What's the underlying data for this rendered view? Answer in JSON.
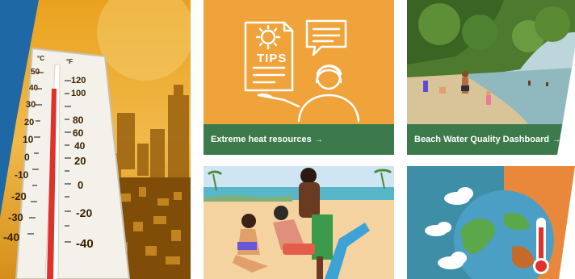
{
  "hero": {
    "image_label": "Thermometer over Boston skyline in heat",
    "scale_labels": [
      "120",
      "100",
      "80",
      "60",
      "40",
      "20",
      "0",
      "-20",
      "-40"
    ],
    "left_scale_labels": [
      "50",
      "40",
      "30",
      "20",
      "10",
      "0",
      "-10",
      "-20",
      "-30",
      "-40"
    ],
    "unit_c": "°C",
    "unit_f": "°F"
  },
  "tiles": [
    {
      "id": "extreme-heat",
      "title": "Extreme heat resources",
      "arrow": "→",
      "illustration_text": "TIPS",
      "bg_color": "#f1a33b",
      "caption_color": "#3c7a4c"
    },
    {
      "id": "beach-water",
      "title": "Beach Water Quality Dashboard",
      "arrow": "→",
      "caption_color": "#3c7a4c"
    },
    {
      "id": "sun-safety",
      "title": ""
    },
    {
      "id": "climate",
      "title": ""
    }
  ],
  "colors": {
    "accent_blue": "#1f68a6",
    "orange": "#f1a33b",
    "green": "#3c7a4c"
  }
}
